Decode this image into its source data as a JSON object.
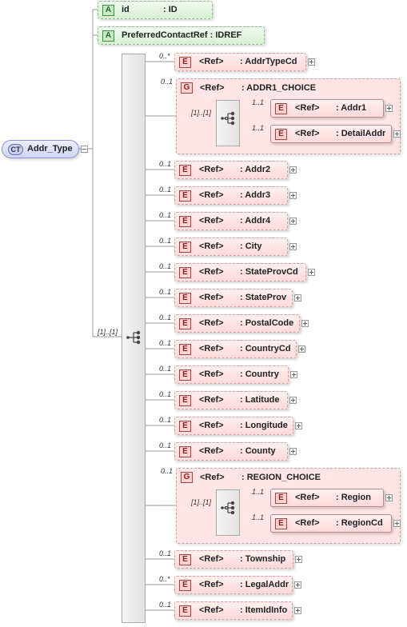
{
  "complex_type": {
    "badge": "CT",
    "name": "Addr_Type"
  },
  "attributes": [
    {
      "badge": "A",
      "name": "id",
      "type": ": ID"
    },
    {
      "badge": "A",
      "name": "PreferredContactRef",
      "type": ": IDREF"
    }
  ],
  "sequence": {
    "cardinality": "[1]..[1]"
  },
  "elements": [
    {
      "card": "0..*",
      "badge": "E",
      "ref": "<Ref>",
      "name": ": AddrTypeCd"
    },
    {
      "card": "0..1",
      "badge": "G",
      "ref": "<Ref>",
      "name": ": ADDR1_CHOICE",
      "choice_card": "[1]..[1]",
      "children": [
        {
          "card": "1..1",
          "badge": "E",
          "ref": "<Ref>",
          "name": ": Addr1"
        },
        {
          "card": "1..1",
          "badge": "E",
          "ref": "<Ref>",
          "name": ": DetailAddr"
        }
      ]
    },
    {
      "card": "0..1",
      "badge": "E",
      "ref": "<Ref>",
      "name": ": Addr2"
    },
    {
      "card": "0..1",
      "badge": "E",
      "ref": "<Ref>",
      "name": ": Addr3"
    },
    {
      "card": "0..1",
      "badge": "E",
      "ref": "<Ref>",
      "name": ": Addr4"
    },
    {
      "card": "0..1",
      "badge": "E",
      "ref": "<Ref>",
      "name": ": City"
    },
    {
      "card": "0..1",
      "badge": "E",
      "ref": "<Ref>",
      "name": ": StateProvCd"
    },
    {
      "card": "0..1",
      "badge": "E",
      "ref": "<Ref>",
      "name": ": StateProv"
    },
    {
      "card": "0..1",
      "badge": "E",
      "ref": "<Ref>",
      "name": ": PostalCode"
    },
    {
      "card": "0..1",
      "badge": "E",
      "ref": "<Ref>",
      "name": ": CountryCd"
    },
    {
      "card": "0..1",
      "badge": "E",
      "ref": "<Ref>",
      "name": ": Country"
    },
    {
      "card": "0..1",
      "badge": "E",
      "ref": "<Ref>",
      "name": ": Latitude"
    },
    {
      "card": "0..1",
      "badge": "E",
      "ref": "<Ref>",
      "name": ": Longitude"
    },
    {
      "card": "0..1",
      "badge": "E",
      "ref": "<Ref>",
      "name": ": County"
    },
    {
      "card": "0..1",
      "badge": "G",
      "ref": "<Ref>",
      "name": ": REGION_CHOICE",
      "choice_card": "[1]..[1]",
      "children": [
        {
          "card": "1..1",
          "badge": "E",
          "ref": "<Ref>",
          "name": ": Region"
        },
        {
          "card": "1..1",
          "badge": "E",
          "ref": "<Ref>",
          "name": ": RegionCd"
        }
      ]
    },
    {
      "card": "0..1",
      "badge": "E",
      "ref": "<Ref>",
      "name": ": Township"
    },
    {
      "card": "0..*",
      "badge": "E",
      "ref": "<Ref>",
      "name": ": LegalAddr"
    },
    {
      "card": "0..1",
      "badge": "E",
      "ref": "<Ref>",
      "name": ": ItemIdInfo"
    }
  ]
}
